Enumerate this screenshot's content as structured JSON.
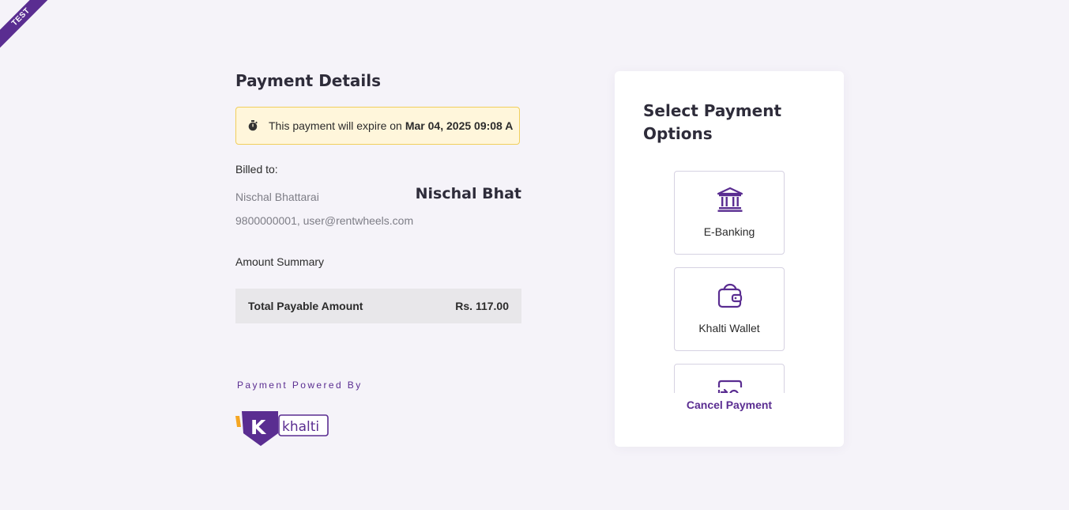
{
  "ribbon": {
    "label": "TEST"
  },
  "payment_details": {
    "title": "Payment Details",
    "expiry": {
      "text": "This payment will expire on",
      "date": "Mar 04, 2025 09:08 A"
    },
    "billed_to": {
      "label": "Billed to:",
      "name": "Nischal Bhattarai",
      "display_name": "Nischal Bhat",
      "contact": "9800000001, user@rentwheels.com"
    },
    "amount_summary": {
      "label": "Amount Summary",
      "total_label": "Total Payable Amount",
      "total_value": "Rs. 117.00"
    },
    "powered_by": "Payment Powered By",
    "logo_text": "khalti"
  },
  "payment_options": {
    "title": "Select Payment Options",
    "options": [
      {
        "label": "E-Banking",
        "icon": "bank-icon"
      },
      {
        "label": "Khalti Wallet",
        "icon": "wallet-icon"
      },
      {
        "label": "",
        "icon": "card-transfer-icon"
      }
    ],
    "cancel_label": "Cancel Payment"
  },
  "colors": {
    "brand": "#5a2d91",
    "accent_yellow": "#f5a623",
    "warning_bg": "#fff6db",
    "warning_border": "#f1cf5c",
    "page_bg": "#f5f3f9"
  }
}
